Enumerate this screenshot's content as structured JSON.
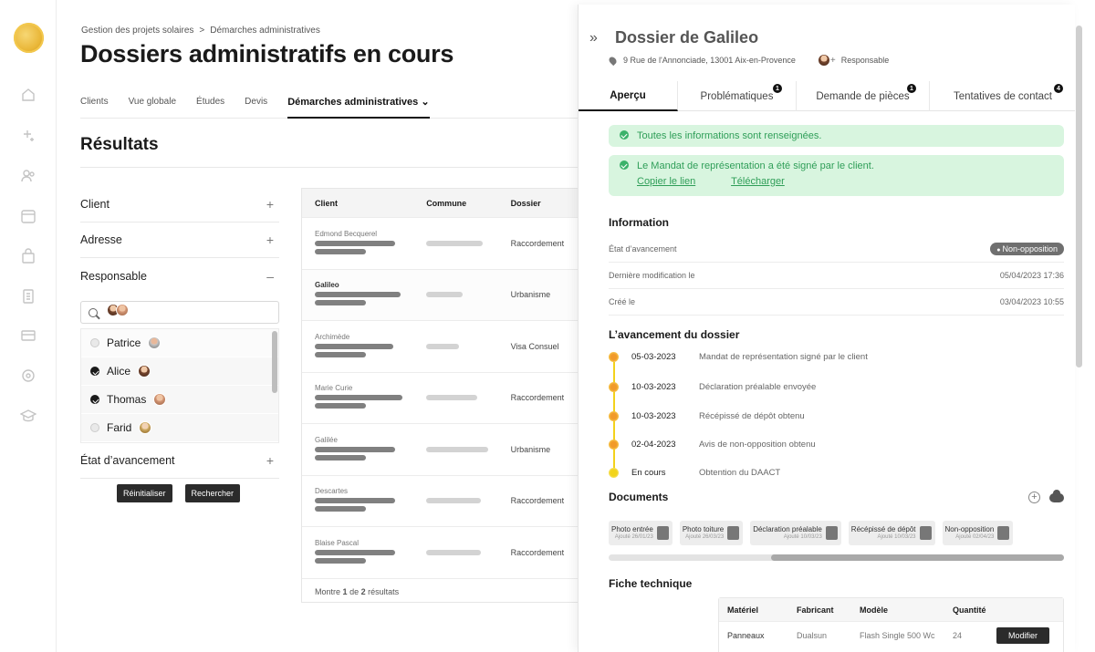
{
  "sidebar": {
    "icons": [
      "home-icon",
      "sparkle-icon",
      "users-icon",
      "calendar-icon",
      "bag-icon",
      "documents-icon",
      "card-icon",
      "help-icon",
      "graduation-icon"
    ]
  },
  "breadcrumb": {
    "items": [
      "Gestion des projets solaires",
      ">",
      "Démarches administratives"
    ]
  },
  "page": {
    "title": "Dossiers administratifs en cours"
  },
  "tabs": [
    "Clients",
    "Vue globale",
    "Études",
    "Devis",
    "Démarches administratives ⌄"
  ],
  "results": {
    "title": "Résultats"
  },
  "filters": {
    "client": "Client",
    "adresse": "Adresse",
    "responsable": "Responsable",
    "etat": "État d’avancement",
    "plus": "+",
    "minus": "–",
    "people": [
      "Patrice",
      "Alice",
      "Thomas",
      "Farid"
    ],
    "reset": "Réinitialiser",
    "search": "Rechercher"
  },
  "table": {
    "headers": [
      "Client",
      "Commune",
      "Dossier"
    ],
    "rows": [
      {
        "client": "Edmond Becquerel",
        "dossier": "Raccordement"
      },
      {
        "client": "Galileo",
        "dossier": "Urbanisme"
      },
      {
        "client": "Archimède",
        "dossier": "Visa Consuel"
      },
      {
        "client": "Marie Curie",
        "dossier": "Raccordement"
      },
      {
        "client": "Galilée",
        "dossier": "Urbanisme"
      },
      {
        "client": "Descartes",
        "dossier": "Raccordement"
      },
      {
        "client": "Blaise Pascal",
        "dossier": "Raccordement"
      }
    ],
    "footer_pre": "Montre",
    "footer_n1": "1",
    "footer_de": "de",
    "footer_n2": "2",
    "footer_post": "résultats"
  },
  "panel": {
    "collapse": "»",
    "title": "Dossier de Galileo",
    "address": "9 Rue de l'Annonciade, 13001 Aix-en-Provence",
    "responsable": "Responsable",
    "tabs": [
      {
        "label": "Aperçu"
      },
      {
        "label": "Problématiques",
        "badge": "1"
      },
      {
        "label": "Demande de pièces",
        "badge": "1"
      },
      {
        "label": "Tentatives de contact",
        "badge": "4"
      }
    ],
    "alert1": "Toutes les informations sont renseignées.",
    "alert2": "Le Mandat de représentation a été signé par le client.",
    "link_copy": "Copier le lien",
    "link_download": "Télécharger",
    "info_title": "Information",
    "info": [
      {
        "label": "État d’avancement",
        "value": "Non-opposition"
      },
      {
        "label": "Dernière modification le",
        "value": "05/04/2023 17:36"
      },
      {
        "label": "Créé le",
        "value": "03/04/2023 10:55"
      }
    ],
    "timeline_title": "L’avancement du dossier",
    "timeline": [
      {
        "date": "05-03-2023",
        "text": "Mandat de représentation signé par le client"
      },
      {
        "date": "10-03-2023",
        "text": "Déclaration préalable envoyée"
      },
      {
        "date": "10-03-2023",
        "text": "Récépissé de dépôt obtenu"
      },
      {
        "date": "02-04-2023",
        "text": "Avis de non-opposition obtenu"
      },
      {
        "date": "En cours",
        "text": "Obtention du DAACT"
      }
    ],
    "documents_title": "Documents",
    "documents": [
      {
        "name": "Photo entrée",
        "added": "Ajouté 26/01/23"
      },
      {
        "name": "Photo toiture",
        "added": "Ajouté 26/03/23"
      },
      {
        "name": "Déclaration préalable",
        "added": "Ajouté 10/03/23"
      },
      {
        "name": "Récépissé de dépôt",
        "added": "Ajouté 10/03/23"
      },
      {
        "name": "Non-opposition",
        "added": "Ajouté 02/04/23"
      }
    ],
    "fiche_title": "Fiche technique",
    "fiche": {
      "headers": [
        "Matériel",
        "Fabricant",
        "Modèle",
        "Quantité"
      ],
      "row": {
        "materiel": "Panneaux",
        "fabricant": "Dualsun",
        "modele": "Flash Single 500 Wc",
        "quantite": "24"
      },
      "modify": "Modifier"
    }
  },
  "colors": {
    "success_bg": "#d8f5df",
    "success_text": "#2f9e58",
    "timeline": "#f19a2a",
    "dark": "#2b2b2b"
  }
}
